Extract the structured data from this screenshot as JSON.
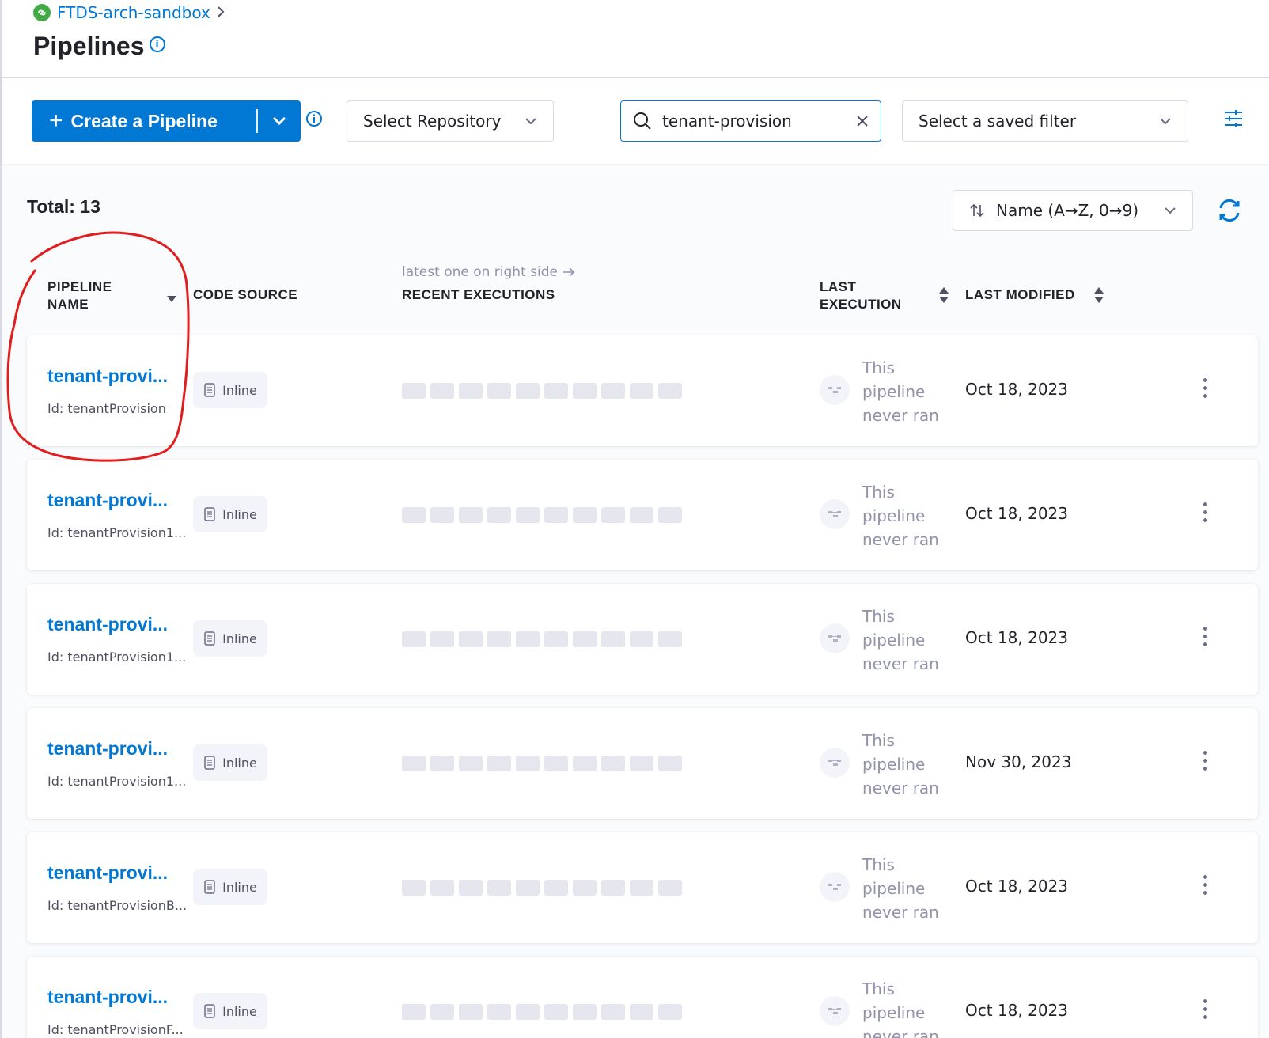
{
  "breadcrumb": {
    "project": "FTDS-arch-sandbox",
    "separator": ">"
  },
  "page": {
    "title": "Pipelines"
  },
  "toolbar": {
    "create_label": "Create a Pipeline",
    "repo_placeholder": "Select Repository",
    "search_value": "tenant-provision",
    "saved_filter_placeholder": "Select a saved filter"
  },
  "list": {
    "total_label": "Total: 13",
    "sort_label": "Name (A→Z, 0→9)"
  },
  "columns": {
    "name_line1": "PIPELINE",
    "name_line2": "NAME",
    "code_source": "CODE SOURCE",
    "recent_hint": "latest one on right side",
    "recent": "RECENT EXECUTIONS",
    "last_line1": "LAST",
    "last_line2": "EXECUTION",
    "last_modified": "LAST MODIFIED"
  },
  "rows": [
    {
      "name": "tenant-provi...",
      "id": "Id: tenantProvision",
      "code_source": "Inline",
      "last_execution": "This pipeline never ran",
      "last_modified": "Oct 18, 2023"
    },
    {
      "name": "tenant-provi...",
      "id": "Id: tenantProvision1...",
      "code_source": "Inline",
      "last_execution": "This pipeline never ran",
      "last_modified": "Oct 18, 2023"
    },
    {
      "name": "tenant-provi...",
      "id": "Id: tenantProvision1...",
      "code_source": "Inline",
      "last_execution": "This pipeline never ran",
      "last_modified": "Oct 18, 2023"
    },
    {
      "name": "tenant-provi...",
      "id": "Id: tenantProvision1...",
      "code_source": "Inline",
      "last_execution": "This pipeline never ran",
      "last_modified": "Nov 30, 2023"
    },
    {
      "name": "tenant-provi...",
      "id": "Id: tenantProvisionB...",
      "code_source": "Inline",
      "last_execution": "This pipeline never ran",
      "last_modified": "Oct 18, 2023"
    },
    {
      "name": "tenant-provi...",
      "id": "Id: tenantProvisionF...",
      "code_source": "Inline",
      "last_execution": "This pipeline never ran",
      "last_modified": "Oct 18, 2023"
    }
  ],
  "colors": {
    "primary": "#0278d5",
    "annotation": "#e11d1d",
    "placeholder_bar": "#e6e6ef"
  }
}
